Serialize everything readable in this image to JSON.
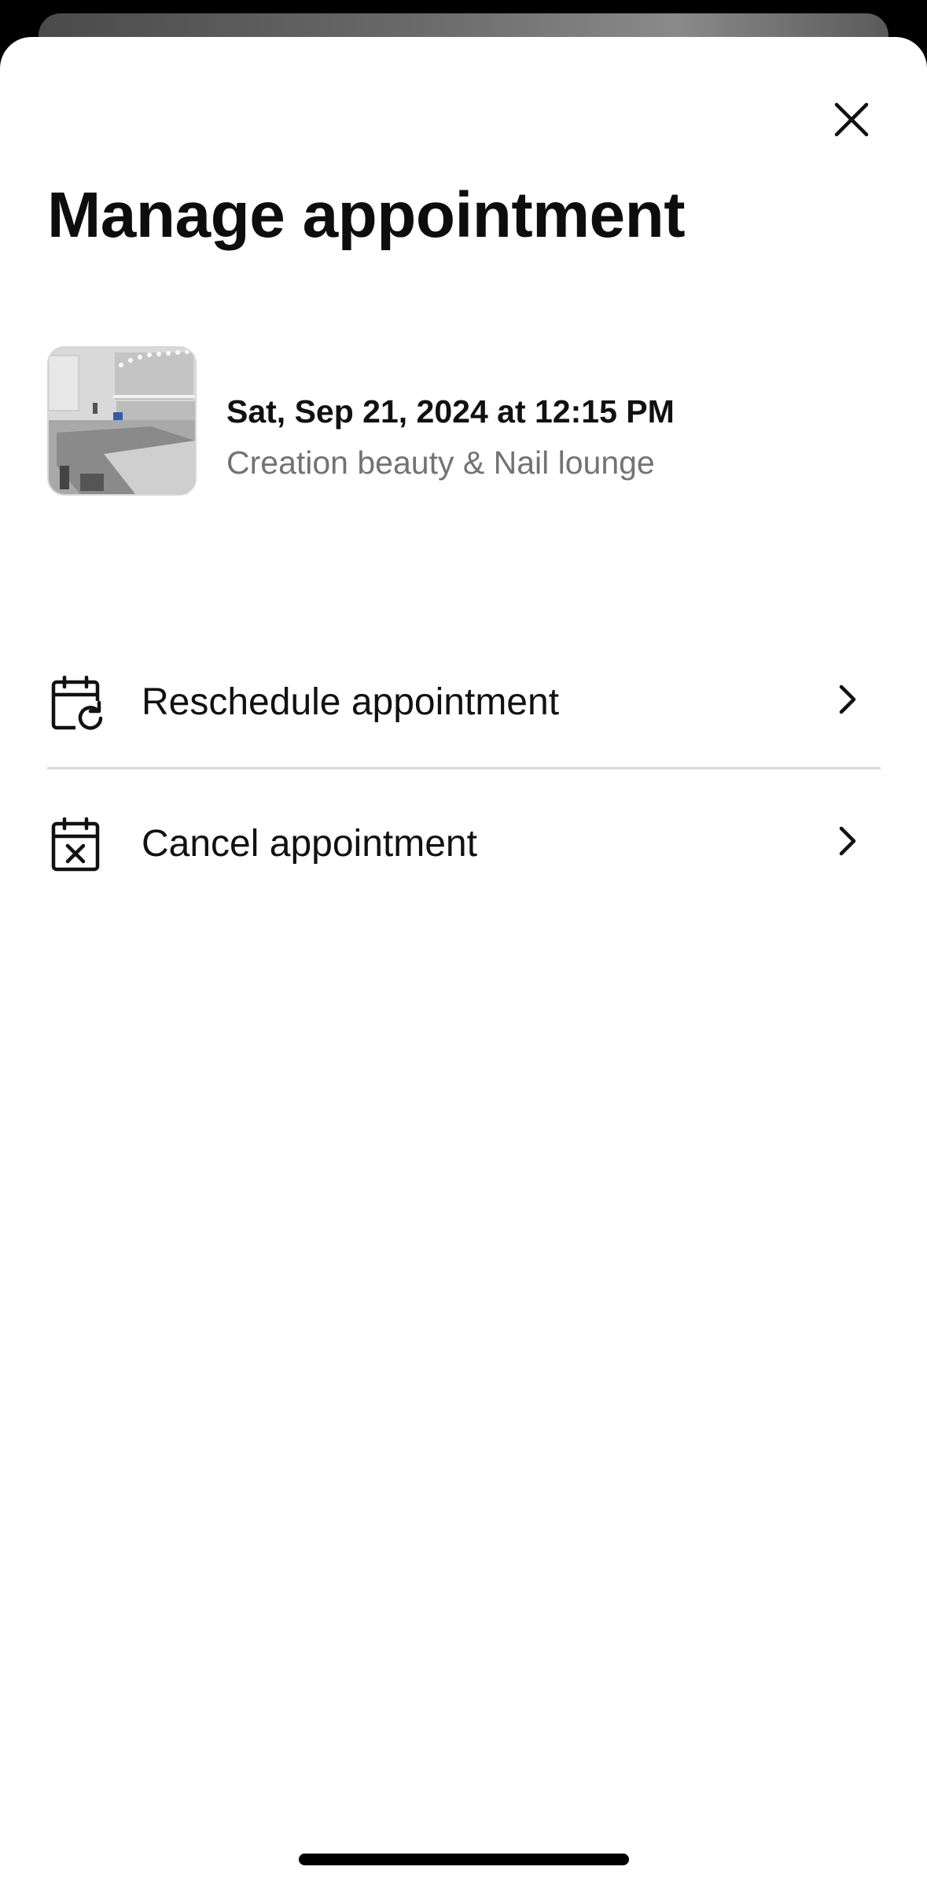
{
  "sheet": {
    "title": "Manage appointment",
    "close_icon": "close-icon"
  },
  "appointment": {
    "datetime": "Sat, Sep 21, 2024 at 12:15 PM",
    "venue": "Creation beauty & Nail lounge",
    "thumbnail": "salon-photo"
  },
  "actions": [
    {
      "label": "Reschedule appointment",
      "icon": "calendar-refresh-icon",
      "chevron": "chevron-right-icon"
    },
    {
      "label": "Cancel appointment",
      "icon": "calendar-x-icon",
      "chevron": "chevron-right-icon"
    }
  ],
  "colors": {
    "text_primary": "#111111",
    "text_secondary": "#737373",
    "divider": "#d9d9d9",
    "background": "#ffffff"
  }
}
